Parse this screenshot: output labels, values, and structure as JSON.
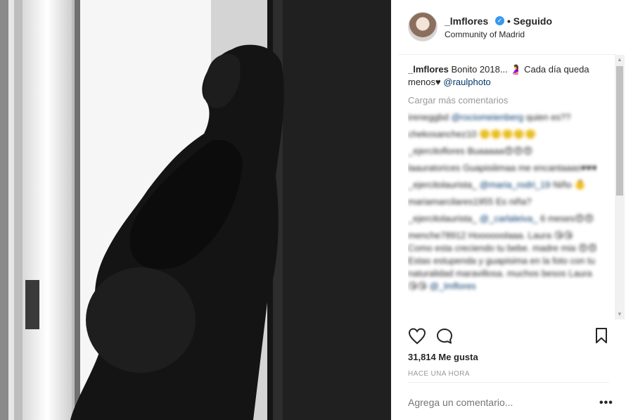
{
  "header": {
    "username": "_lmflores",
    "separator": "•",
    "follow_status": "Seguido",
    "location": "Community of Madrid"
  },
  "caption": {
    "username": "_lmflores",
    "text": "Bonito 2018... 🤰 Cada día queda menos♥",
    "mention": "@raulphoto"
  },
  "comments": {
    "load_more": "Cargar más comentarios",
    "items": [
      {
        "user": "ireneggbd",
        "mention": "@rociomeienberg",
        "text": "quien es??"
      },
      {
        "user": "chekosanchez10",
        "mention": "",
        "text": "🙂🙂🙂🙂🙂"
      },
      {
        "user": "_ejercitoflores",
        "mention": "",
        "text": "Buaaaaa😍😍😍"
      },
      {
        "user": "laauratorices",
        "mention": "",
        "text": "Guapisiiimaa me encantaaas♥♥♥"
      },
      {
        "user": "_ejercitolaurista_",
        "mention": "@maria_rodri_19",
        "text": "Niño 👶"
      },
      {
        "user": "mariamarcilares1955",
        "mention": "",
        "text": "Es niña?"
      },
      {
        "user": "_ejercitolaurista_",
        "mention": "@_carlaleiva_",
        "text": "6 meses😍😍"
      },
      {
        "user": "menche78912",
        "mention": "@_lmflores",
        "text": "Hoooooolaaa. Laura 😘😘 Como esta creciendo tu bebe. madre mia 😍😍 Estas estupenda y guapisima en la foto con tu naturalidad maravillosa. muchos besos Laura 😘😘"
      }
    ]
  },
  "likes": "31,814 Me gusta",
  "time": "HACE UNA HORA",
  "add_comment": {
    "placeholder": "Agrega un comentario..."
  },
  "more_options": "•••",
  "colors": {
    "link": "#003569",
    "verified": "#3897f0",
    "muted": "#999999"
  },
  "icons": [
    "heart-icon",
    "comment-icon",
    "bookmark-icon",
    "verified-badge-icon",
    "scroll-up-icon",
    "scroll-down-icon"
  ]
}
